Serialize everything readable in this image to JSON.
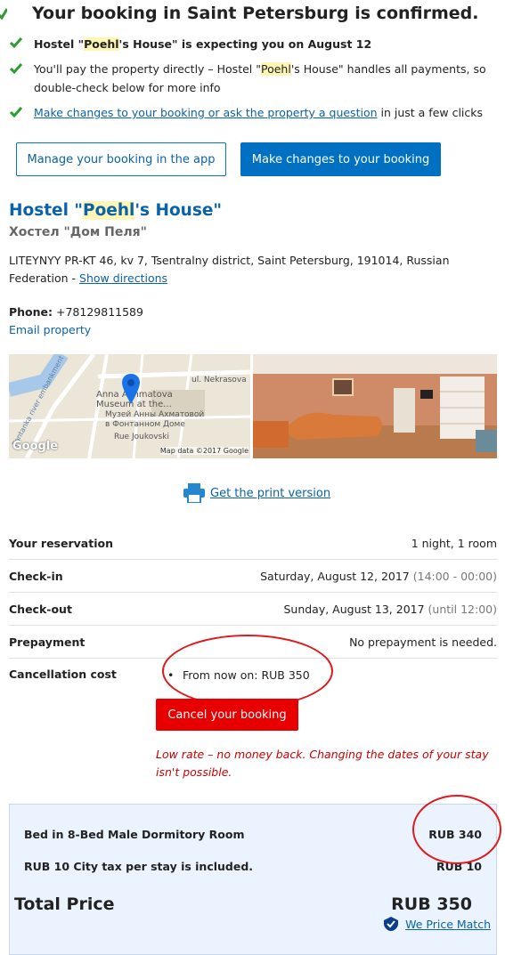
{
  "header": {
    "title": "Your booking in Saint Petersburg is confirmed."
  },
  "bullets": {
    "b1_pre": "Hostel \"",
    "b1_hl": "Poehl",
    "b1_mid": "'s House\" is expecting you on ",
    "b1_date": "August 12",
    "b2_pre": "You'll pay the property directly – Hostel \"",
    "b2_hl": "Poehl",
    "b2_post": "'s House\" handles all payments, so double-check below for more info",
    "b3_link": "Make changes to your booking or ask the property a question",
    "b3_post": " in just a few clicks"
  },
  "buttons": {
    "manage": "Manage your booking in the app",
    "make_changes": "Make changes to your booking",
    "cancel": "Cancel your booking"
  },
  "hotel": {
    "name_pre": "Hostel \"",
    "name_hl": "Poehl",
    "name_post": "'s House\"",
    "name_ru": "Хостел \"Дом Пеля\"",
    "address": "LITEYNYY PR-KT 46, kv 7, Tsentralny district, Saint Petersburg, 191014, Russian Federation - ",
    "directions": "Show directions",
    "phone_label": "Phone:",
    "phone": " +78129811589",
    "email": "Email property"
  },
  "map": {
    "street1": "ul. Nekrasova",
    "museum1": "Anna Akhmatova",
    "museum2": "Museum at the...",
    "ru1": "Музей Анны Ахматовой",
    "ru2": "в Фонтанном Доме",
    "street2": "Rue Joukovski",
    "river": "Fontanka river embankment",
    "logo": "Google",
    "credit": "Map data ©2017 Google"
  },
  "print": {
    "label": "Get the print version"
  },
  "reservation": {
    "rows": [
      {
        "label": "Your reservation",
        "value": "1 night, 1 room",
        "extra": ""
      },
      {
        "label": "Check-in",
        "value": "Saturday, August 12, 2017 ",
        "extra": "(14:00 - 00:00)"
      },
      {
        "label": "Check-out",
        "value": "Sunday, August 13, 2017 ",
        "extra": "(until 12:00)"
      },
      {
        "label": "Prepayment",
        "value": "No prepayment is needed.",
        "extra": ""
      }
    ],
    "cancellation_label": "Cancellation cost",
    "cancellation_value": "From now on: RUB 350"
  },
  "policy": {
    "low_rate": "Low rate – no money back. Changing the dates of your stay isn't possible."
  },
  "price": {
    "room_label": "Bed in 8-Bed Male Dormitory Room",
    "room_price": "RUB 340",
    "tax_label": "RUB 10 City tax per stay is included.",
    "tax_price": "RUB 10",
    "total_label": "Total Price",
    "total_price": "RUB 350",
    "price_match": "We Price Match"
  },
  "colors": {
    "link": "#0a62a8",
    "primary_button": "#0071c2",
    "cancel_button": "#e80000",
    "check": "#2c9c2c",
    "annotation": "#e0191c"
  }
}
